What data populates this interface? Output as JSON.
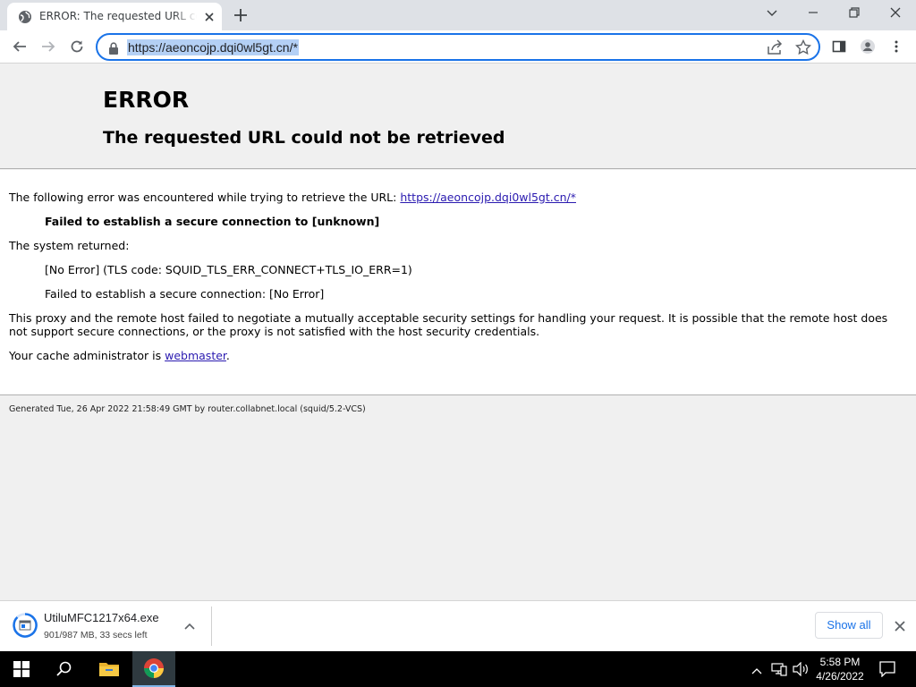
{
  "browser": {
    "tab": {
      "title": "ERROR: The requested URL could not be retrieved",
      "favicon": "globe-icon"
    },
    "address_bar": {
      "url": "https://aeoncojp.dqi0wl5gt.cn/*"
    }
  },
  "page": {
    "title": "ERROR",
    "subtitle": "The requested URL could not be retrieved",
    "intro_text": "The following error was encountered while trying to retrieve the URL: ",
    "intro_link": "https://aeoncojp.dqi0wl5gt.cn/*",
    "error_message": "Failed to establish a secure connection to [unknown]",
    "system_returned_label": "The system returned:",
    "system_code": "[No Error] (TLS code: SQUID_TLS_ERR_CONNECT+TLS_IO_ERR=1)",
    "system_detail": "Failed to establish a secure connection: [No Error]",
    "explanation": "This proxy and the remote host failed to negotiate a mutually acceptable security settings for handling your request. It is possible that the remote host does not support secure connections, or the proxy is not satisfied with the host security credentials.",
    "admin_prefix": "Your cache administrator is ",
    "admin_link": "webmaster",
    "admin_suffix": ".",
    "footer": "Generated Tue, 26 Apr 2022 21:58:49 GMT by router.collabnet.local (squid/5.2-VCS)"
  },
  "download": {
    "filename": "UtiluMFC1217x64.exe",
    "status": "901/987 MB, 33 secs left",
    "show_all_label": "Show all"
  },
  "taskbar": {
    "time": "5:58 PM",
    "date": "4/26/2022"
  },
  "colors": {
    "accent": "#1a73e8",
    "link": "#2a1ab0",
    "selection": "#b4d0f5"
  }
}
